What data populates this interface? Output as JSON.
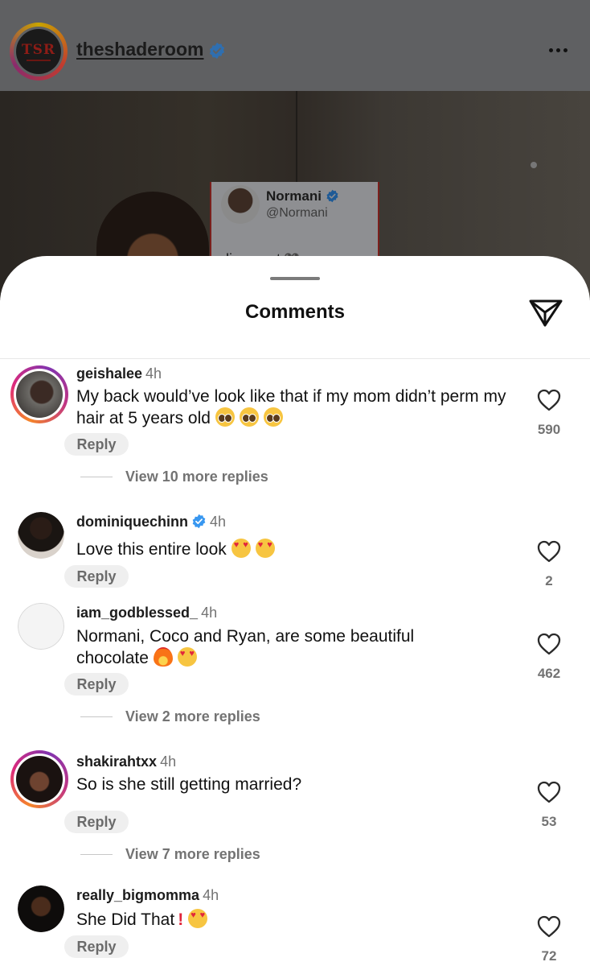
{
  "post": {
    "username": "theshaderoom",
    "avatar_logo": "TSR",
    "more_icon": "more-horizontal-icon",
    "tweet": {
      "name": "Normani",
      "handle": "@Normani",
      "text": "alignment",
      "emoji": "🖤"
    }
  },
  "sheet": {
    "title": "Comments",
    "share_icon": "paper-plane-icon"
  },
  "comments": [
    {
      "username": "geishalee",
      "time": "4h",
      "text": "My back would’ve look like that if my mom didn’t perm my hair at 5 years old",
      "likes": "590",
      "reply_label": "Reply",
      "view_replies": "View 10 more replies"
    },
    {
      "username": "dominiquechinn",
      "time": "4h",
      "text": "Love this entire look",
      "likes": "2",
      "reply_label": "Reply"
    },
    {
      "username": "iam_godblessed_",
      "time": "4h",
      "text": "Normani, Coco and Ryan, are some beautiful chocolate",
      "likes": "462",
      "reply_label": "Reply",
      "view_replies": "View 2 more replies"
    },
    {
      "username": "shakirahtxx",
      "time": "4h",
      "text": "So is she still getting married?",
      "likes": "53",
      "reply_label": "Reply",
      "view_replies": "View 7 more replies"
    },
    {
      "username": "really_bigmomma",
      "time": "4h",
      "text": "She Did That",
      "likes": "72",
      "reply_label": "Reply"
    }
  ],
  "colors": {
    "verified_blue": "#3897f0",
    "story_ring": "#dd2a7b",
    "muted_text": "#737373"
  }
}
